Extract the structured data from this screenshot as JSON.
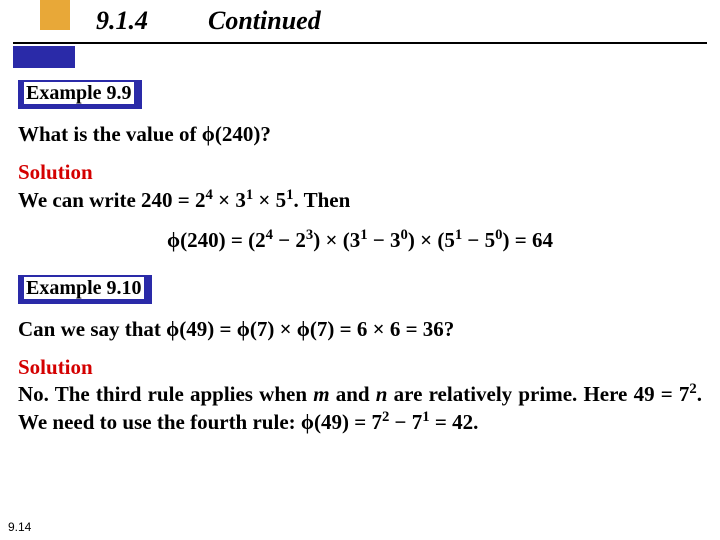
{
  "header": {
    "section_number": "9.1.4",
    "section_title": "Continued"
  },
  "example1": {
    "label": "Example 9.9",
    "question_pre": "What is the value of ",
    "question_phi": "ϕ",
    "question_post": "(240)?",
    "solution_label": "Solution",
    "solution_text_a": "We can write 240 = 2",
    "solution_text_b": " × 3",
    "solution_text_c": " × 5",
    "solution_text_d": ". Then",
    "formula_a": "ϕ(240) = (2",
    "formula_b": " − 2",
    "formula_c": ") × (3",
    "formula_d": " − 3",
    "formula_e": ") × (5",
    "formula_f": " − 5",
    "formula_g": ") = 64",
    "e4": "4",
    "e3": "3",
    "e1": "1",
    "e0": "0"
  },
  "example2": {
    "label": "Example 9.10",
    "q_a": "Can we say that ",
    "q_b": "ϕ",
    "q_c": "(49) = ",
    "q_d": "ϕ",
    "q_e": "(7) × ",
    "q_f": "ϕ",
    "q_g": "(7) = 6 × 6 = 36?",
    "solution_label": "Solution",
    "ans_a": "No. The third rule applies when ",
    "ans_m": "m",
    "ans_b": " and ",
    "ans_n": "n",
    "ans_c": " are relatively prime. Here 49 = 7",
    "ans_d": ". We need to use the fourth rule: ",
    "ans_e": "ϕ",
    "ans_f": "(49) = 7",
    "ans_g": " − 7",
    "ans_h": " = 42.",
    "e2": "2",
    "e1": "1"
  },
  "page_number": "9.14"
}
